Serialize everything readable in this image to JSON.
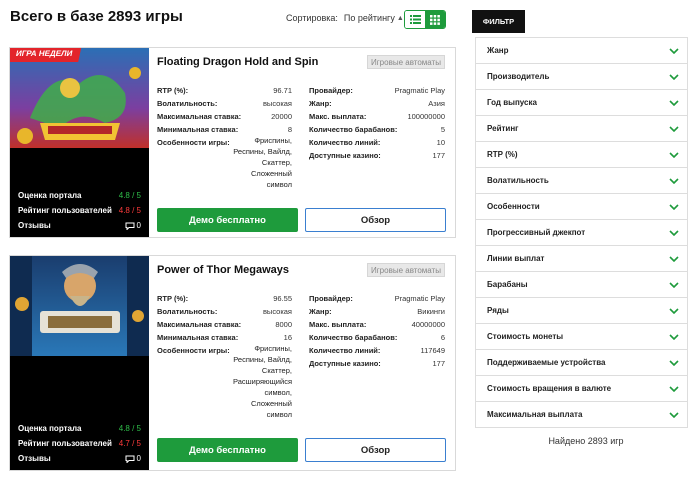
{
  "header": {
    "title": "Всего в базе 2893 игры",
    "sort_label": "Сортировка:",
    "sort_value": "По рейтингу"
  },
  "games": [
    {
      "badge": "ИГРА НЕДЕЛИ",
      "title": "Floating Dragon Hold and Spin",
      "category": "Игровые автоматы",
      "left_specs": [
        {
          "k": "RTP (%):",
          "v": "96.71"
        },
        {
          "k": "Волатильность:",
          "v": "высокая"
        },
        {
          "k": "Максимальная ставка:",
          "v": "20000"
        },
        {
          "k": "Минимальная ставка:",
          "v": "8"
        }
      ],
      "features_label": "Особенности игры:",
      "features": [
        "Фриспины,",
        "Респины, Вайлд,",
        "Скаттер,",
        "Сложенный",
        "символ"
      ],
      "right_specs": [
        {
          "k": "Провайдер:",
          "v": "Pragmatic Play"
        },
        {
          "k": "Жанр:",
          "v": "Азия"
        },
        {
          "k": "Макс. выплата:",
          "v": "100000000"
        },
        {
          "k": "Количество барабанов:",
          "v": "5"
        },
        {
          "k": "Количество линий:",
          "v": "10"
        },
        {
          "k": "Доступные казино:",
          "v": "177"
        }
      ],
      "portal_rating_label": "Оценка портала",
      "portal_rating": "4.8 / 5",
      "user_rating_label": "Рейтинг пользователей",
      "user_rating": "4.8 / 5",
      "reviews_label": "Отзывы",
      "reviews_count": "0",
      "demo_label": "Демо бесплатно",
      "review_label": "Обзор"
    },
    {
      "title": "Power of Thor Megaways",
      "category": "Игровые автоматы",
      "left_specs": [
        {
          "k": "RTP (%):",
          "v": "96.55"
        },
        {
          "k": "Волатильность:",
          "v": "высокая"
        },
        {
          "k": "Максимальная ставка:",
          "v": "8000"
        },
        {
          "k": "Минимальная ставка:",
          "v": "16"
        }
      ],
      "features_label": "Особенности игры:",
      "features": [
        "Фриспины,",
        "Респины, Вайлд,",
        "Скаттер,",
        "Расширяющийся",
        "символ,",
        "Сложенный",
        "символ"
      ],
      "right_specs": [
        {
          "k": "Провайдер:",
          "v": "Pragmatic Play"
        },
        {
          "k": "Жанр:",
          "v": "Викинги"
        },
        {
          "k": "Макс. выплата:",
          "v": "40000000"
        },
        {
          "k": "Количество барабанов:",
          "v": "6"
        },
        {
          "k": "Количество линий:",
          "v": "117649"
        },
        {
          "k": "Доступные казино:",
          "v": "177"
        }
      ],
      "portal_rating_label": "Оценка портала",
      "portal_rating": "4.8 / 5",
      "user_rating_label": "Рейтинг пользователей",
      "user_rating": "4.7 / 5",
      "reviews_label": "Отзывы",
      "reviews_count": "0",
      "demo_label": "Демо бесплатно",
      "review_label": "Обзор"
    }
  ],
  "filter": {
    "tab_label": "ФИЛЬТР",
    "items": [
      "Жанр",
      "Производитель",
      "Год выпуска",
      "Рейтинг",
      "RTP (%)",
      "Волатильность",
      "Особенности",
      "Прогрессивный джекпот",
      "Линии выплат",
      "Барабаны",
      "Ряды",
      "Стоимость монеты",
      "Поддерживаемые устройства",
      "Стоимость вращения в валюте",
      "Максимальная выплата"
    ],
    "found": "Найдено 2893 игр"
  },
  "colors": {
    "accent": "#1e9b3c",
    "badge": "#e3242b",
    "link_border": "#3a7fd0"
  }
}
